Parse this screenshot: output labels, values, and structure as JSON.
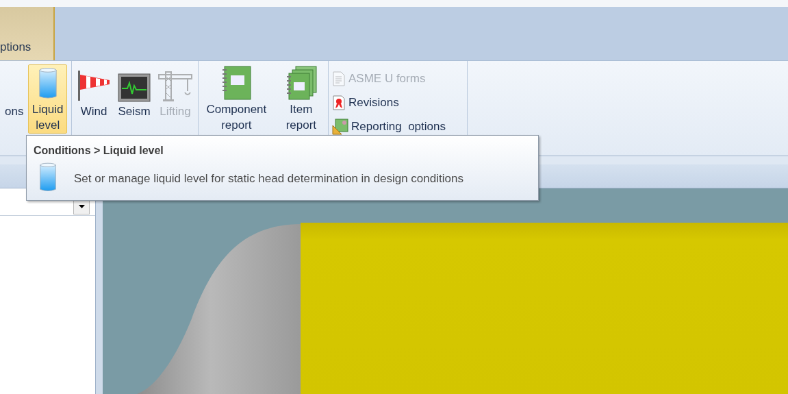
{
  "tabs": [
    {
      "label": "ptions",
      "selected": true
    }
  ],
  "ribbon": {
    "groups": [
      {
        "items": [
          {
            "kind": "large",
            "label": "ons",
            "highlighted": false,
            "disabled": false
          },
          {
            "kind": "large",
            "label": "Liquid level",
            "highlighted": true,
            "disabled": false
          }
        ]
      },
      {
        "items": [
          {
            "kind": "large",
            "label": "Wind",
            "highlighted": false,
            "disabled": false
          },
          {
            "kind": "large",
            "label": "Seism",
            "highlighted": false,
            "disabled": false
          },
          {
            "kind": "large",
            "label": "Lifting",
            "highlighted": false,
            "disabled": true
          }
        ]
      },
      {
        "items": [
          {
            "kind": "large",
            "label": "Component report",
            "highlighted": false,
            "disabled": false
          },
          {
            "kind": "large",
            "label": "Item report",
            "highlighted": false,
            "disabled": false
          }
        ]
      },
      {
        "items": [
          {
            "kind": "small",
            "label": "ASME U forms",
            "highlighted": false,
            "disabled": true
          },
          {
            "kind": "small",
            "label": "Revisions",
            "highlighted": false,
            "disabled": false
          },
          {
            "kind": "small",
            "label": "Reporting  options",
            "highlighted": false,
            "disabled": false
          }
        ]
      }
    ]
  },
  "tooltip": {
    "title": "Conditions > Liquid level",
    "text": "Set or manage liquid level for static head determination in design conditions"
  }
}
